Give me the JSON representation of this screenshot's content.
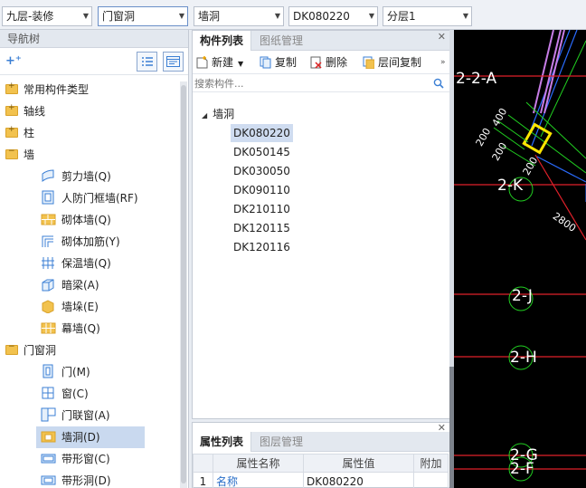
{
  "toolbar": {
    "floor": "九层-装修",
    "category": "门窗洞",
    "type": "墙洞",
    "component": "DK080220",
    "layer": "分层1"
  },
  "nav": {
    "title": "导航树",
    "folders": {
      "common": "常用构件类型",
      "axis": "轴线",
      "column": "柱",
      "wall": "墙",
      "opening": "门窗洞"
    },
    "wall_items": [
      "剪力墙(Q)",
      "人防门框墙(RF)",
      "砌体墙(Q)",
      "砌体加筋(Y)",
      "保温墙(Q)",
      "暗梁(A)",
      "墙垛(E)",
      "幕墙(Q)"
    ],
    "opening_items": [
      "门(M)",
      "窗(C)",
      "门联窗(A)",
      "墙洞(D)",
      "带形窗(C)",
      "带形洞(D)"
    ]
  },
  "component_panel": {
    "tabs": [
      "构件列表",
      "图纸管理"
    ],
    "actions": {
      "new": "新建",
      "copy": "复制",
      "delete": "删除",
      "floor_copy": "层间复制"
    },
    "search_placeholder": "搜索构件...",
    "group": "墙洞",
    "items": [
      "DK080220",
      "DK050145",
      "DK030050",
      "DK090110",
      "DK210110",
      "DK120115",
      "DK120116"
    ],
    "selected": "DK080220"
  },
  "property_panel": {
    "tabs": [
      "属性列表",
      "图层管理"
    ],
    "columns": [
      "属性名称",
      "属性值",
      "附加"
    ],
    "rows": [
      {
        "index": "1",
        "name": "名称",
        "value": "DK080220"
      }
    ]
  },
  "cad": {
    "labels": [
      "2-2-A",
      "2-K",
      "2-J",
      "2-H",
      "2-G",
      "2-F"
    ],
    "dims": [
      "400",
      "200",
      "200",
      "200",
      "2800"
    ]
  },
  "colors": {
    "selection": "#c9d9ef",
    "grid_red": "#e0202a",
    "dim_green": "#21d021",
    "folder": "#f2c24e"
  }
}
